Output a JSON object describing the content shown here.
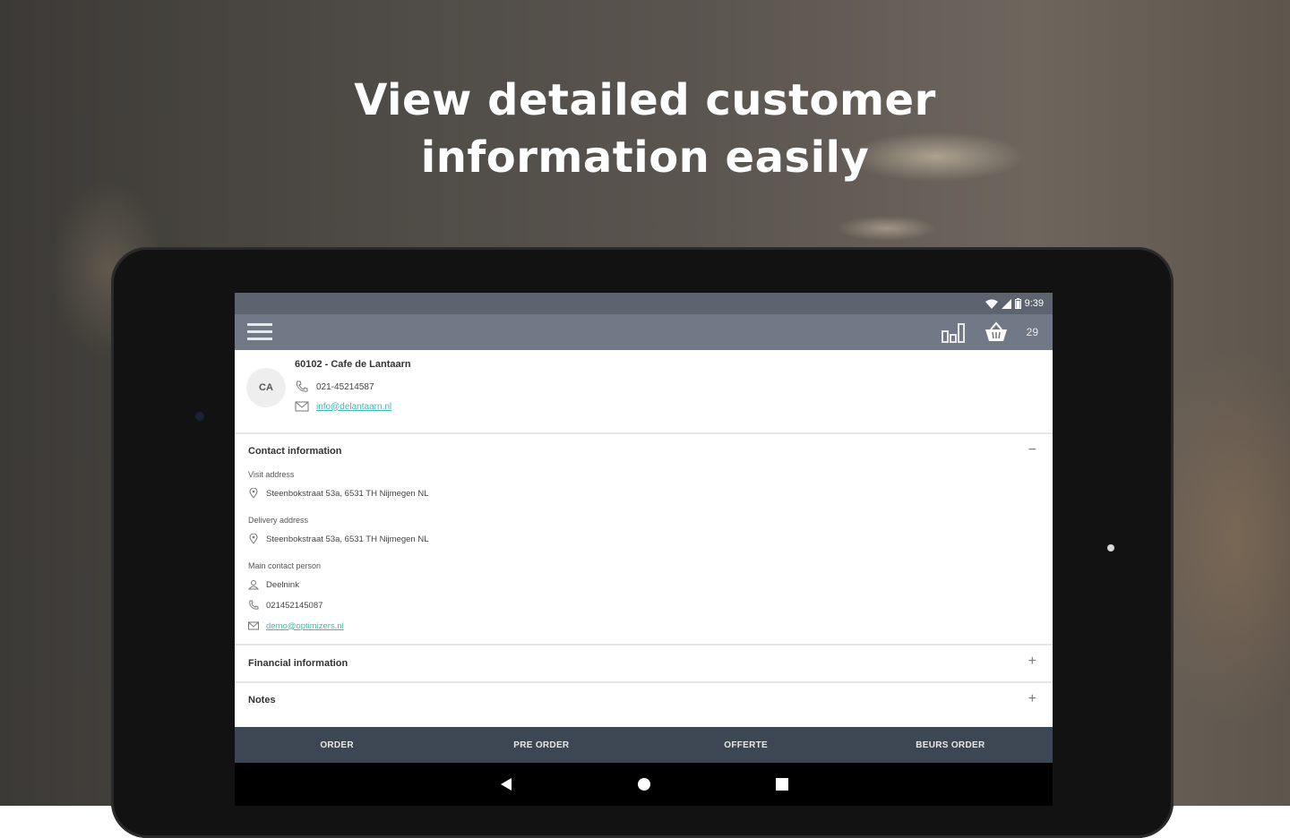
{
  "headline": {
    "line1": "View detailed customer",
    "line2": "information easily"
  },
  "statusbar": {
    "time": "9:39",
    "icons": [
      "wifi-icon",
      "signal-icon",
      "battery-icon"
    ]
  },
  "appbar": {
    "menu_icon": "hamburger-menu-icon",
    "chart_icon": "bar-chart-icon",
    "basket_icon": "shopping-basket-icon",
    "basket_count": "29"
  },
  "customer": {
    "initials": "CA",
    "title": "60102 - Cafe de Lantaarn",
    "phone": "021-45214587",
    "email": "info@delantaarn.nl"
  },
  "contact_section": {
    "title": "Contact information",
    "toggle": "−",
    "visit_label": "Visit address",
    "visit_address": "Steenbokstraat 53a, 6531 TH Nijmegen NL",
    "delivery_label": "Delivery address",
    "delivery_address": "Steenbokstraat 53a, 6531 TH Nijmegen NL",
    "main_contact_label": "Main contact person",
    "contact_name": "Deelnink",
    "contact_phone": "021452145087",
    "contact_email": "demo@optimizers.nl"
  },
  "financial_section": {
    "title": "Financial information",
    "toggle": "+"
  },
  "notes_section": {
    "title": "Notes",
    "toggle": "+"
  },
  "bottom_tabs": [
    "ORDER",
    "PRE ORDER",
    "OFFERTE",
    "BEURS ORDER"
  ],
  "colors": {
    "statusbar": "#5d6470",
    "appbar": "#717986",
    "bottom_tabs": "#3d4653",
    "link": "#3fb7b0"
  }
}
